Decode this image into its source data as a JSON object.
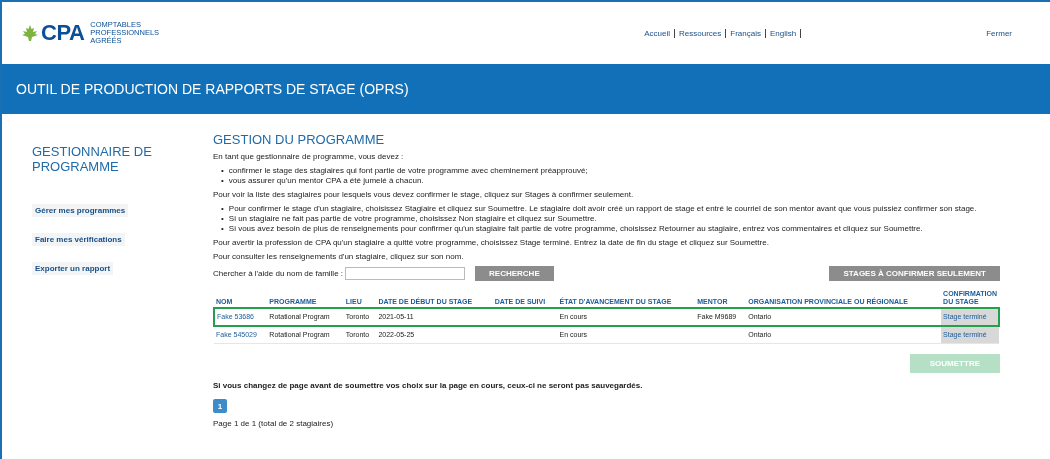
{
  "header": {
    "logo": {
      "wordmark": "CPA",
      "tagline": [
        "COMPTABLES",
        "PROFESSIONNELS",
        "AGRÉÉS"
      ]
    },
    "nav": [
      "Accueil",
      "Ressources",
      "Français",
      "English"
    ],
    "close_link": "Fermer"
  },
  "banner": {
    "title": "OUTIL DE PRODUCTION DE RAPPORTS DE STAGE (OPRS)"
  },
  "sidebar": {
    "title": "GESTIONNAIRE DE PROGRAMME",
    "items": [
      {
        "label": "Gérer mes programmes"
      },
      {
        "label": "Faire mes vérifications"
      },
      {
        "label": "Exporter un rapport"
      }
    ]
  },
  "main": {
    "title": "GESTION DU PROGRAMME",
    "blocks": [
      {
        "kind": "para",
        "text": "En tant que gestionnaire de programme, vous devez :"
      },
      {
        "kind": "list",
        "bullet": "•",
        "items": [
          "confirmer le stage des stagiaires qui font partie de votre programme avec cheminement préapprouvé;",
          "vous assurer qu'un mentor CPA a été jumelé à chacun."
        ]
      },
      {
        "kind": "para",
        "text": "Pour voir la liste des stagiaires pour lesquels vous devez confirmer le stage, cliquez sur Stages à confirmer seulement."
      },
      {
        "kind": "list",
        "bullet": "•",
        "items": [
          "Pour confirmer le stage d'un stagiaire, choisissez Stagiaire et cliquez sur Soumettre. Le stagiaire doit avoir créé un rapport de stage et entré le courriel de son mentor avant que vous puissiez confirmer son stage.",
          "Si un stagiaire ne fait pas partie de votre programme, choisissez Non stagiaire et cliquez sur Soumettre.",
          "Si vous avez besoin de plus de renseignements pour confirmer qu'un stagiaire fait partie de votre programme, choisissez Retourner au stagiaire, entrez vos commentaires et cliquez sur Soumettre."
        ]
      },
      {
        "kind": "para",
        "text": "Pour avertir la profession de CPA qu'un stagiaire a quitté votre programme, choisissez Stage terminé. Entrez la date de fin du stage et cliquez sur Soumettre."
      },
      {
        "kind": "para",
        "text": "Pour consulter les renseignements d'un stagiaire, cliquez sur son nom."
      }
    ],
    "search": {
      "label": "Chercher à l'aide du nom de famille :",
      "button": "RECHERCHE"
    },
    "filter_button": "STAGES À CONFIRMER SEULEMENT",
    "table": {
      "columns": [
        "NOM",
        "PROGRAMME",
        "LIEU",
        "DATE DE DÉBUT DU STAGE",
        "DATE DE SUIVI",
        "ÉTAT D'AVANCEMENT DU STAGE",
        "MENTOR",
        "ORGANISATION PROVINCIALE OU RÉGIONALE",
        "CONFIRMATION DU STAGE"
      ],
      "rows": [
        {
          "highlighted": true,
          "cells": [
            "Fake 53686",
            "Rotational Program",
            "Toronto",
            "2021-05-11",
            "",
            "En cours",
            "Fake M9689",
            "Ontario",
            "Stage terminé"
          ]
        },
        {
          "highlighted": false,
          "cells": [
            "Fake 545029",
            "Rotational Program",
            "Toronto",
            "2022-05-25",
            "",
            "En cours",
            "",
            "Ontario",
            "Stage terminé"
          ]
        }
      ]
    },
    "submit": {
      "label": "SOUMETTRE",
      "disabled": true
    },
    "warning": "Si vous changez de page avant de soumettre vos choix sur la page en cours, ceux-ci ne seront pas sauvegardés.",
    "pages": [
      {
        "label": "1",
        "selected": true
      }
    ],
    "page_info": "Page 1 de 1 (total de 2 stagiaires)"
  }
}
